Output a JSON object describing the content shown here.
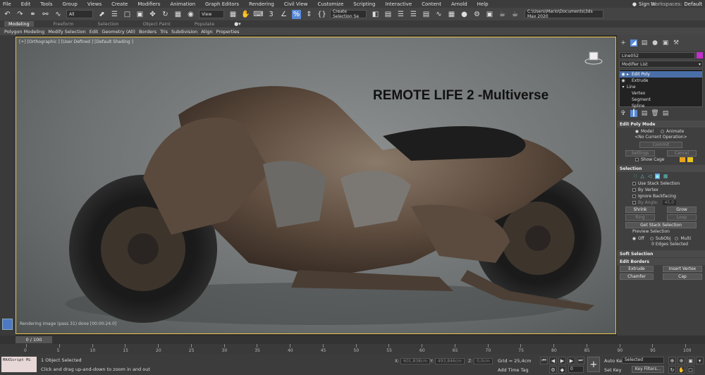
{
  "menu": [
    "File",
    "Edit",
    "Tools",
    "Group",
    "Views",
    "Create",
    "Modifiers",
    "Animation",
    "Graph Editors",
    "Rendering",
    "Civil View",
    "Customize",
    "Scripting",
    "Interactive",
    "Content",
    "Arnold",
    "Help"
  ],
  "signin": "Sign In",
  "workspaces_label": "Workspaces:",
  "workspaces_value": "Default",
  "toolbar": {
    "filter": "All",
    "refcoord": "View",
    "selset": "Create Selection Se",
    "path": "C:\\Users\\Mario\\Documents\\3ds Max 2020"
  },
  "ribbon_tabs": [
    "Modeling",
    "Freeform",
    "Selection",
    "Object Paint",
    "Populate"
  ],
  "ribbon_items": [
    "Polygon Modeling",
    "Modify Selection",
    "Edit",
    "Geometry (All)",
    "Borders",
    "Tris",
    "Subdivision",
    "Align",
    "Properties"
  ],
  "viewport": {
    "label": "[+] [Orthographic ] [User Defined ] [Default Shading ]",
    "title": "REMOTE LIFE 2 -Multiverse",
    "render_status": "Rendering image (pass 31)  done [00:00:24.0]"
  },
  "panel": {
    "object_name": "Line052",
    "object_color": "#c12fc9",
    "modifier_list": "Modifier List",
    "stack": [
      {
        "label": "Edit Poly",
        "selected": true
      },
      {
        "label": "Extrude",
        "selected": false
      },
      {
        "label": "Line",
        "selected": false
      },
      {
        "label": "Vertex",
        "selected": false
      },
      {
        "label": "Segment",
        "selected": false
      },
      {
        "label": "Spline",
        "selected": false
      }
    ],
    "edit_poly_mode": {
      "title": "Edit Poly Mode",
      "model": "Model",
      "animate": "Animate",
      "current_op": "<No Current Operation>",
      "commit": "Commit",
      "settings": "Settings",
      "cancel": "Cancel",
      "show_cage": "Show Cage",
      "cage_color1": "#e8a21c",
      "cage_color2": "#e8c41c"
    },
    "selection": {
      "title": "Selection",
      "use_stack": "Use Stack Selection",
      "by_vertex": "By Vertex",
      "ignore_backfacing": "Ignore Backfacing",
      "by_angle": "By Angle:",
      "angle_value": "45,0",
      "shrink": "Shrink",
      "grow": "Grow",
      "ring": "Ring",
      "loop": "Loop",
      "get_stack": "Get Stack Selection",
      "preview_label": "Preview Selection",
      "off": "Off",
      "subobj": "SubObj",
      "multi": "Multi",
      "summary": "0 Edges Selected"
    },
    "soft_selection": "Soft Selection",
    "edit_borders": {
      "title": "Edit Borders",
      "extrude": "Extrude",
      "insert_vertex": "Insert Vertex",
      "chamfer": "Chamfer",
      "cap": "Cap"
    }
  },
  "timeline": {
    "frame": "0 / 100",
    "ticks": [
      "0",
      "5",
      "10",
      "15",
      "20",
      "25",
      "30",
      "35",
      "40",
      "45",
      "50",
      "55",
      "60",
      "65",
      "70",
      "75",
      "80",
      "85",
      "90",
      "95",
      "100"
    ]
  },
  "status": {
    "maxscript": "MAXScript Mi",
    "selected": "1 Object Selected",
    "hint": "Click and drag up-and-down to zoom in and out",
    "x_label": "X:",
    "x_value": "601,838cm",
    "y_label": "Y:",
    "y_value": "493,846cm",
    "z_label": "Z:",
    "z_value": "0,0cm",
    "grid": "Grid = 25,4cm",
    "add_time_tag": "Add Time Tag",
    "auto_key": "Auto Key",
    "set_key": "Set Key",
    "key_mode": "Selected",
    "key_filters": "Key Filters...",
    "frame_field": "0"
  }
}
